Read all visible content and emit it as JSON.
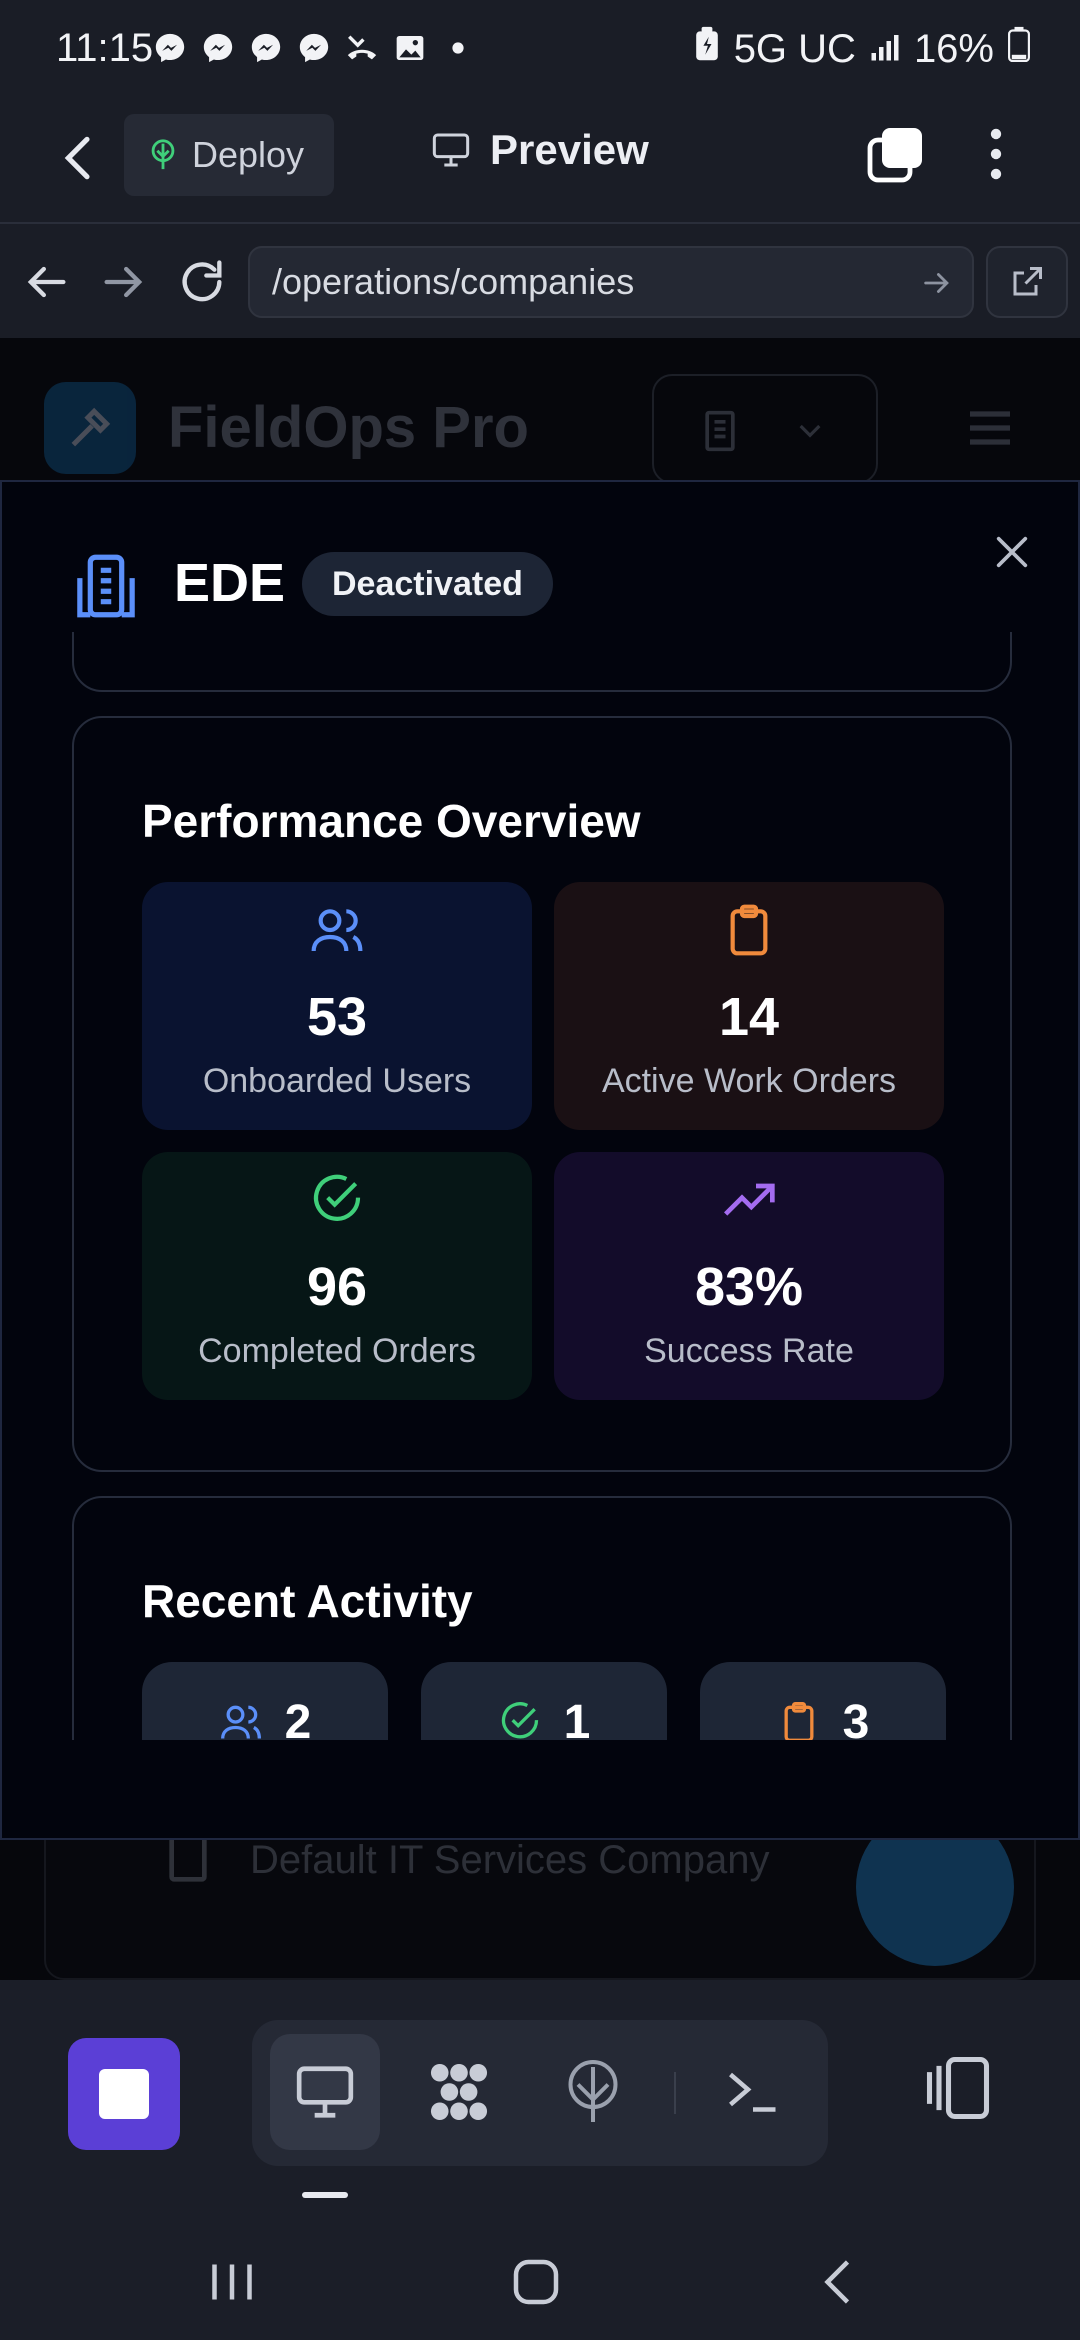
{
  "status_bar": {
    "time": "11:15",
    "network": "5G UC",
    "battery": "16%",
    "notification_icons": [
      "messenger-icon",
      "messenger-icon",
      "messenger-icon",
      "messenger-icon",
      "missed-call-icon",
      "gallery-icon",
      "dot-icon"
    ]
  },
  "browser": {
    "deploy_label": "Deploy",
    "preview_label": "Preview",
    "url": "/operations/companies"
  },
  "background_page": {
    "app_title": "FieldOps Pro",
    "company_name": "Default IT Services Company"
  },
  "modal": {
    "title": "EDE",
    "status_badge": "Deactivated",
    "performance": {
      "title": "Performance Overview",
      "stats": [
        {
          "value": "53",
          "label": "Onboarded Users",
          "icon": "users-icon",
          "color": "#5b8ff9"
        },
        {
          "value": "14",
          "label": "Active Work Orders",
          "icon": "clipboard-icon",
          "color": "#f08a3c"
        },
        {
          "value": "96",
          "label": "Completed Orders",
          "icon": "check-circle-icon",
          "color": "#3fcf7a"
        },
        {
          "value": "83%",
          "label": "Success Rate",
          "icon": "trending-up-icon",
          "color": "#a46cf0"
        }
      ]
    },
    "activity": {
      "title": "Recent Activity",
      "items": [
        {
          "value": "2",
          "icon": "users-icon"
        },
        {
          "value": "1",
          "icon": "check-circle-icon"
        },
        {
          "value": "3",
          "icon": "clipboard-icon"
        }
      ]
    }
  },
  "colors": {
    "accent_purple": "#5b3fd6",
    "modal_bg": "#02040d",
    "stat_blue_bg": "#0a1330",
    "stat_orange_bg": "#1a1014",
    "stat_green_bg": "#061616",
    "stat_purple_bg": "#130c2a"
  }
}
